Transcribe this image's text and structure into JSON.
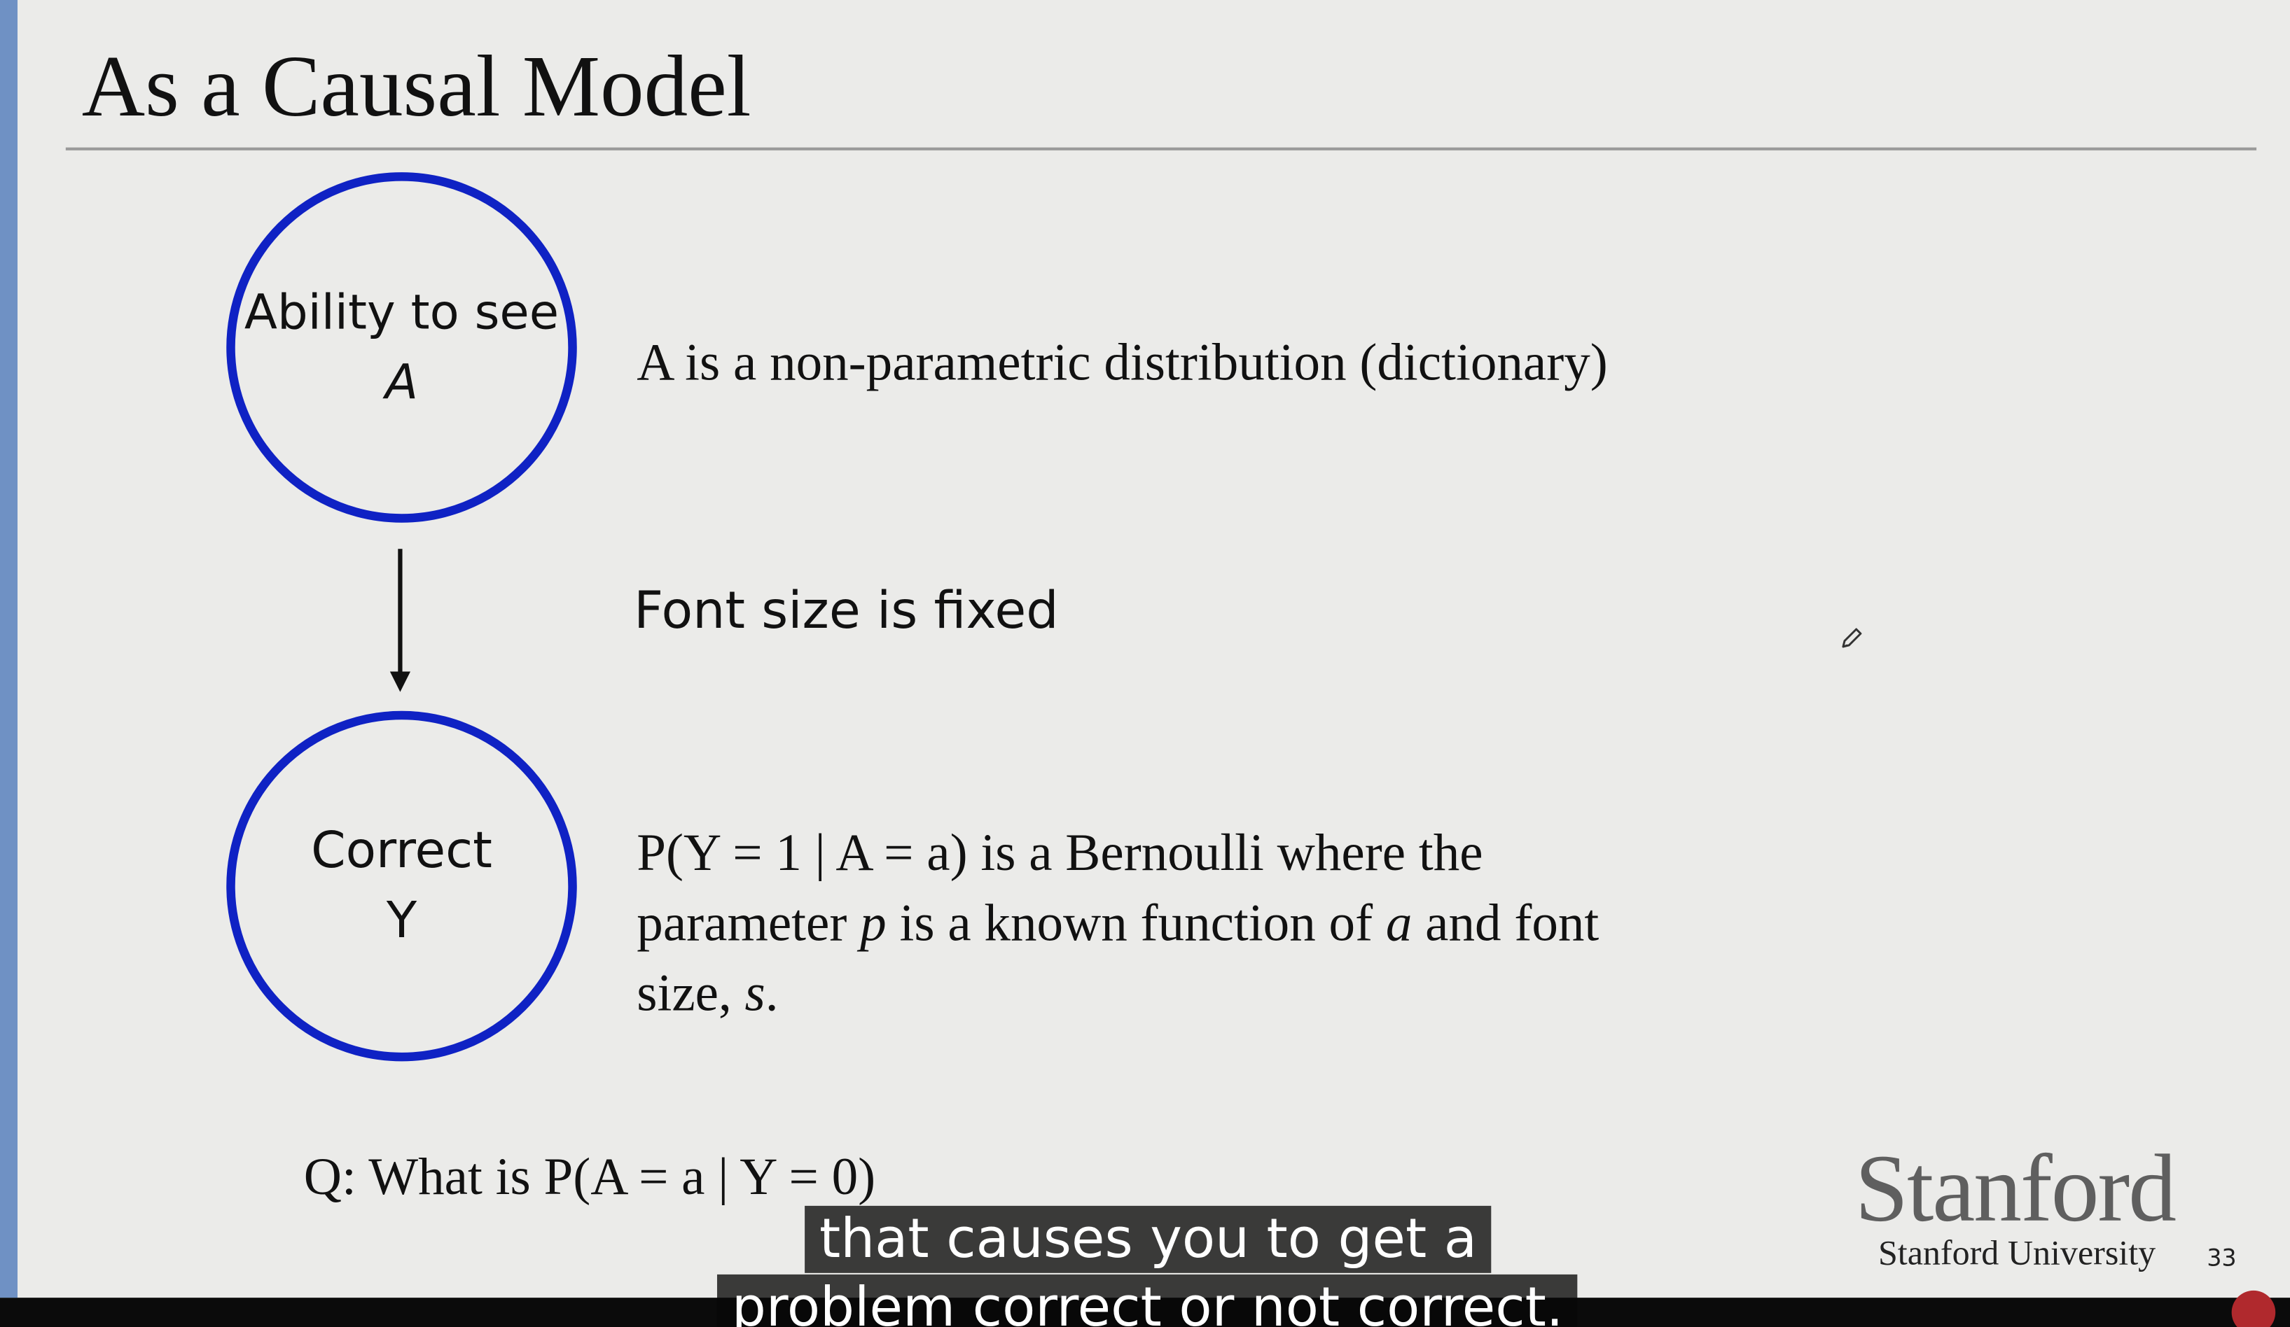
{
  "slide": {
    "title": "As a Causal Model",
    "slide_number": "33"
  },
  "diagram": {
    "nodes": [
      {
        "id": "A",
        "label_line1": "Ability to see",
        "label_line2": "A",
        "border_color": "#0f22c4"
      },
      {
        "id": "Y",
        "label_line1": "Correct",
        "label_line2": "Y",
        "border_color": "#0f22c4"
      }
    ],
    "edges": [
      {
        "from": "A",
        "to": "Y"
      }
    ]
  },
  "descriptions": {
    "a": "A is a non-parametric distribution (dictionary)",
    "font": "Font size is fixed",
    "y_part1": "P(Y = 1 | A = a) is a Bernoulli where the",
    "y_part2": "parameter ",
    "y_p": "p",
    "y_part3": " is a known function of ",
    "y_a": "a",
    "y_part4": " and font",
    "y_part5": "size, ",
    "y_s": "s",
    "y_part6": "."
  },
  "question": "Q: What is P(A = a | Y = 0)",
  "branding": {
    "logo_text": "Stanford",
    "university": "Stanford University",
    "logo_color": "#5f5f5f"
  },
  "caption": {
    "line1": "that causes you to get a",
    "line2": "problem correct or not correct."
  },
  "icons": {
    "pen": "pen-cursor-icon",
    "avatar": "channel-avatar-icon"
  }
}
